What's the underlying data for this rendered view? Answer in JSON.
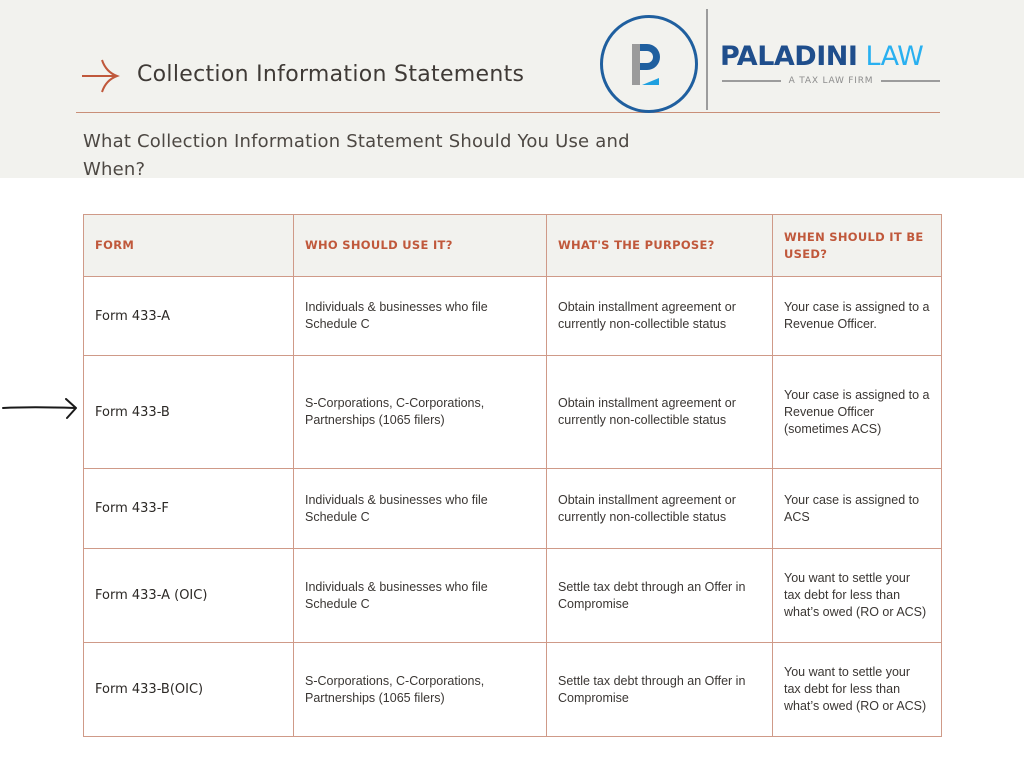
{
  "header": {
    "title": "Collection Information Statements",
    "subtitle": "What Collection Information Statement Should You Use and When?",
    "title_icon": "arrow-right-icon",
    "accent_color": "#c0583b",
    "background_color": "#f2f2ee"
  },
  "logo": {
    "monogram": "P",
    "brand_primary": "PALADINI",
    "brand_secondary": "LAW",
    "tagline": "A TAX LAW FIRM",
    "primary_color": "#1f4e8c",
    "secondary_color": "#29b0f0"
  },
  "pointer": {
    "icon": "hand-drawn-arrow-icon",
    "points_to_row": "Form 433-B"
  },
  "table": {
    "headers": [
      "FORM",
      "WHO SHOULD USE IT?",
      "WHAT'S THE PURPOSE?",
      "WHEN SHOULD IT BE USED?"
    ],
    "rows": [
      {
        "form": "Form 433-A",
        "who": "Individuals & businesses who file Schedule C",
        "purpose": "Obtain installment agreement or currently non-collectible status",
        "when": "Your case is assigned to a Revenue Officer."
      },
      {
        "form": "Form 433-B",
        "who": "S-Corporations, C-Corporations, Partnerships (1065 filers)",
        "purpose": "Obtain installment agreement or currently non-collectible status",
        "when": "Your case is assigned to a Revenue Officer (sometimes ACS)"
      },
      {
        "form": "Form 433-F",
        "who": "Individuals & businesses who file Schedule C",
        "purpose": "Obtain installment agreement or currently non-collectible status",
        "when": "Your case is assigned to ACS"
      },
      {
        "form": "Form 433-A (OIC)",
        "who": "Individuals & businesses who file Schedule C",
        "purpose": "Settle tax debt through an Offer in Compromise",
        "when": "You want to settle your tax debt for less than what’s owed (RO or ACS)"
      },
      {
        "form": "Form 433-B(OIC)",
        "who": "S-Corporations, C-Corporations, Partnerships (1065 filers)",
        "purpose": "Settle tax debt through an Offer in Compromise",
        "when": "You want to settle your tax debt for less than what’s owed (RO or ACS)"
      }
    ]
  }
}
